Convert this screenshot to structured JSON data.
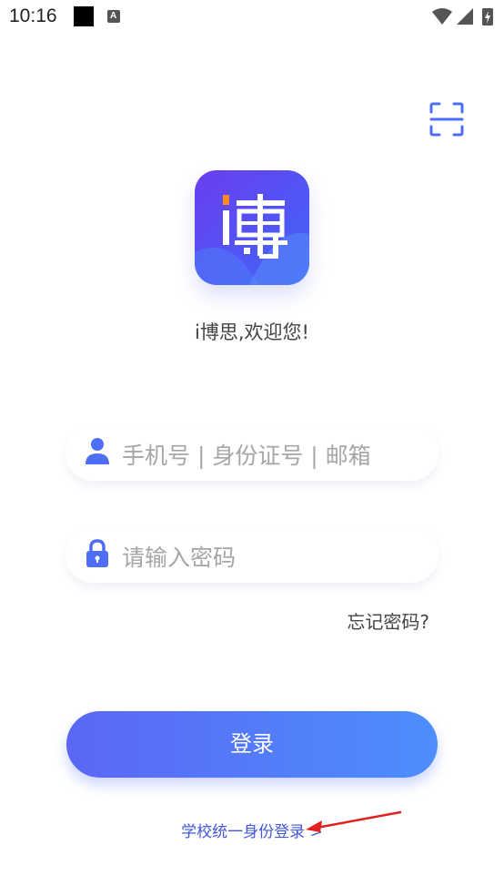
{
  "status_bar": {
    "time": "10:16",
    "notif_letter": "A",
    "icons": [
      "notification-square-icon",
      "font-a-icon",
      "wifi-icon",
      "signal-icon",
      "battery-icon"
    ]
  },
  "scan": {
    "icon": "scan-icon"
  },
  "logo": {
    "glyph": "博",
    "gradient": [
      "#6a3df0",
      "#3f67f6"
    ],
    "accent": "#ff8a1f"
  },
  "welcome": "i博思,欢迎您!",
  "username": {
    "placeholder": "手机号 | 身份证号 | 邮箱",
    "value": "",
    "icon": "user-icon"
  },
  "password": {
    "placeholder": "请输入密码",
    "value": "",
    "icon": "lock-icon"
  },
  "forgot": "忘记密码?",
  "login": "登录",
  "sso": "学校统一身份登录 >",
  "colors": {
    "accent": "#4d6ef5",
    "button_gradient": [
      "#5b67f6",
      "#4d8efc"
    ],
    "link": "#4257d9",
    "annotation_arrow": "#e22020"
  }
}
